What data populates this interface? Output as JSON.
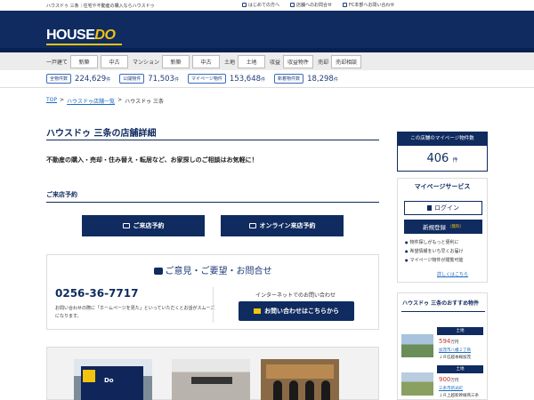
{
  "top_strip": {
    "tagline": "ハウスドゥ 三条｜住宅や不動産の購入ならハウスドゥ",
    "links": [
      "はじめての方へ",
      "店舗へのお問合せ",
      "FC本部へお問い合わせ"
    ]
  },
  "header": {
    "logo_main": "HOUSE",
    "logo_accent": "DO"
  },
  "catnav": {
    "groups": [
      {
        "label": "一戸建て",
        "buttons": [
          "新築",
          "中古"
        ]
      },
      {
        "label": "マンション",
        "buttons": [
          "新築",
          "中古"
        ]
      },
      {
        "label": "土地",
        "buttons": [
          "土地"
        ]
      },
      {
        "label": "収益",
        "buttons": [
          "収益物件"
        ]
      },
      {
        "label": "売却",
        "buttons": [
          "売却相談"
        ]
      }
    ]
  },
  "counts": [
    {
      "tag": "全物件数",
      "value": "224,629",
      "unit": "件"
    },
    {
      "tag": "公開物件",
      "value": "71,503",
      "unit": "件"
    },
    {
      "tag": "マイページ物件",
      "value": "153,648",
      "unit": "件"
    },
    {
      "tag": "新着物件数",
      "value": "18,298",
      "unit": "件"
    }
  ],
  "breadcrumb": [
    "TOP",
    "ハウスドゥ店舗一覧",
    "ハウスドゥ 三条"
  ],
  "main": {
    "title": "ハウスドゥ 三条の店舗詳細",
    "lead": "不動産の購入・売却・住み替え・転居など、お家探しのご相談はお気軽に！",
    "reserve_title": "ご来店予約",
    "reserve_btn": "ご来店予約",
    "online_btn": "オンライン来店予約"
  },
  "contact": {
    "head": "ご意見・ご要望・お問合せ",
    "phone": "0256-36-7717",
    "phone_note": "お問い合わせの際に「ホームページを見た」といっていただくとお話がスムーズになります。",
    "net_label": "インターネットでのお問い合わせ",
    "net_btn": "お問い合わせはこちらから"
  },
  "photos": {
    "p1_sign": "Do",
    "p2_sign": "",
    "p3_sign": ""
  },
  "sidebar": {
    "count_head": "この店舗のマイページ物件数",
    "count_value": "406",
    "count_unit": "件",
    "mypage_head": "マイページサービス",
    "login": "ログイン",
    "register": "新規登録",
    "register_note": "（無料）",
    "features": [
      "物件探しがもっと便利に",
      "希望情報をいち早くお届け",
      "マイページ物件が閲覧可能"
    ],
    "more": "詳しくはこちら",
    "rec_head": "ハウスドゥ 三条のおすすめ物件",
    "rec_items": [
      {
        "type": "土地",
        "price": "594",
        "unit": "万円",
        "addr": "加茂市八幡２丁目",
        "line": "ＪＲ信越本線加茂"
      },
      {
        "type": "土地",
        "price": "900",
        "unit": "万円",
        "addr": "三条市新光町",
        "line": "ＪＲ上越新幹線燕三条"
      }
    ]
  }
}
